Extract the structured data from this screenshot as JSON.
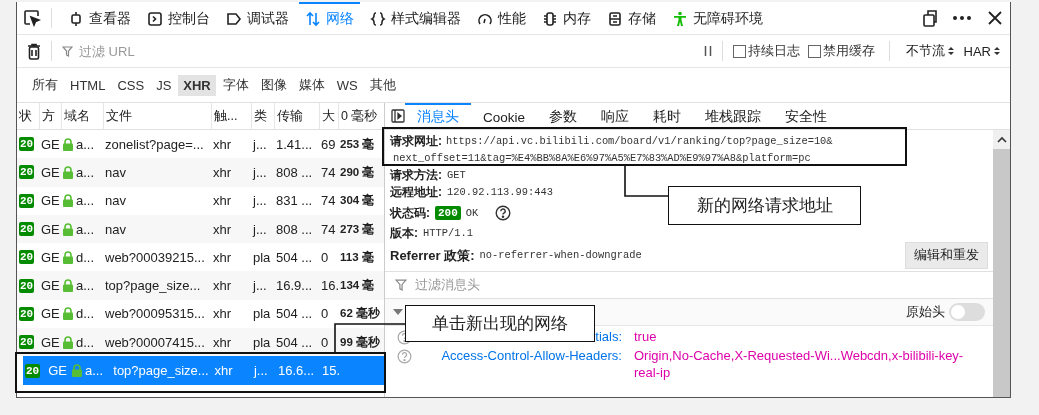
{
  "toolbar": {
    "tabs": [
      {
        "label": "查看器",
        "selected": false
      },
      {
        "label": "控制台",
        "selected": false
      },
      {
        "label": "调试器",
        "selected": false
      },
      {
        "label": "网络",
        "selected": true
      },
      {
        "label": "样式编辑器",
        "selected": false
      },
      {
        "label": "性能",
        "selected": false
      },
      {
        "label": "内存",
        "selected": false
      },
      {
        "label": "存储",
        "selected": false
      },
      {
        "label": "无障碍环境",
        "selected": false
      }
    ]
  },
  "filter_bar": {
    "placeholder": "过滤 URL",
    "options": [
      {
        "label": "持续日志",
        "checked": false
      },
      {
        "label": "禁用缓存",
        "checked": false
      }
    ],
    "throttle": "不节流",
    "har": "HAR"
  },
  "type_filters": [
    {
      "label": "所有",
      "selected": false
    },
    {
      "label": "HTML",
      "selected": false
    },
    {
      "label": "CSS",
      "selected": false
    },
    {
      "label": "JS",
      "selected": false
    },
    {
      "label": "XHR",
      "selected": true
    },
    {
      "label": "字体",
      "selected": false
    },
    {
      "label": "图像",
      "selected": false
    },
    {
      "label": "媒体",
      "selected": false
    },
    {
      "label": "WS",
      "selected": false
    },
    {
      "label": "其他",
      "selected": false
    }
  ],
  "requests": {
    "columns": [
      "状",
      "方",
      "域名",
      "文件",
      "触...",
      "类",
      "传输",
      "大",
      "0 毫秒"
    ],
    "rows": [
      {
        "status": "20",
        "method": "GE",
        "domain": "a...",
        "file": "zonelist?page=...",
        "cause": "xhr",
        "type": "j...",
        "transferred": "1.41...",
        "size": "69",
        "time": "253 毫",
        "selected": false
      },
      {
        "status": "20",
        "method": "GE",
        "domain": "a...",
        "file": "nav",
        "cause": "xhr",
        "type": "j...",
        "transferred": "808 ...",
        "size": "74",
        "time": "290 毫",
        "selected": false
      },
      {
        "status": "20",
        "method": "GE",
        "domain": "a...",
        "file": "nav",
        "cause": "xhr",
        "type": "j...",
        "transferred": "831 ...",
        "size": "74",
        "time": "304 毫",
        "selected": false
      },
      {
        "status": "20",
        "method": "GE",
        "domain": "a...",
        "file": "nav",
        "cause": "xhr",
        "type": "j...",
        "transferred": "808 ...",
        "size": "74",
        "time": "273 毫",
        "selected": false
      },
      {
        "status": "20",
        "method": "GE",
        "domain": "d...",
        "file": "web?00039215...",
        "cause": "xhr",
        "type": "pla",
        "transferred": "504 ...",
        "size": "0",
        "time": "113 毫",
        "selected": false
      },
      {
        "status": "20",
        "method": "GE",
        "domain": "a...",
        "file": "top?page_size...",
        "cause": "xhr",
        "type": "j...",
        "transferred": "16.9...",
        "size": "16.",
        "time": "134 毫",
        "selected": false
      },
      {
        "status": "20",
        "method": "GE",
        "domain": "d...",
        "file": "web?00095315...",
        "cause": "xhr",
        "type": "pla",
        "transferred": "504 ...",
        "size": "0",
        "time": "62 毫秒",
        "selected": false
      },
      {
        "status": "20",
        "method": "GE",
        "domain": "d...",
        "file": "web?00007415...",
        "cause": "xhr",
        "type": "pla",
        "transferred": "504 ...",
        "size": "0",
        "time": "99 毫秒",
        "selected": false
      },
      {
        "status": "20",
        "method": "GE",
        "domain": "a...",
        "file": "top?page_size...",
        "cause": "xhr",
        "type": "j...",
        "transferred": "16.6...",
        "size": "15.",
        "time": "",
        "selected": true
      }
    ]
  },
  "details": {
    "tabs": [
      {
        "label": "消息头",
        "selected": true
      },
      {
        "label": "Cookie",
        "selected": false
      },
      {
        "label": "参数",
        "selected": false
      },
      {
        "label": "响应",
        "selected": false
      },
      {
        "label": "耗时",
        "selected": false
      },
      {
        "label": "堆栈跟踪",
        "selected": false
      },
      {
        "label": "安全性",
        "selected": false
      }
    ],
    "url_label": "请求网址:",
    "url_lines": [
      "https://api.vc.bilibili.com/board/v1/ranking/top?page_size=10&",
      "next_offset=11&tag=%E4%BB%8A%E6%97%A5%E7%83%AD%E9%97%A8&platform=pc"
    ],
    "fields": [
      {
        "kind": "text",
        "label": "请求方法:",
        "value": "GET"
      },
      {
        "kind": "text",
        "label": "远程地址:",
        "value": "120.92.113.99:443"
      },
      {
        "kind": "status",
        "label": "状态码:",
        "code": "200",
        "value": "OK"
      },
      {
        "kind": "text",
        "label": "版本:",
        "value": "HTTP/1.1"
      },
      {
        "kind": "referrer",
        "label": "Referrer 政策:",
        "value": "no-referrer-when-downgrade"
      }
    ],
    "resend_button": "编辑和重发",
    "filter_placeholder": "过滤消息头",
    "raw_headers": {
      "label": "原始头",
      "on": false
    },
    "headers": [
      {
        "name": "tials:",
        "value": "true"
      },
      {
        "name": "Access-Control-Allow-Headers:",
        "value": "Origin,No-Cache,X-Requested-Wi...Webcdn,x-bilibili-key-real-ip"
      }
    ]
  },
  "annotations": [
    {
      "text": "新的网络请求地址"
    },
    {
      "text": "单击新出现的网络"
    }
  ]
}
